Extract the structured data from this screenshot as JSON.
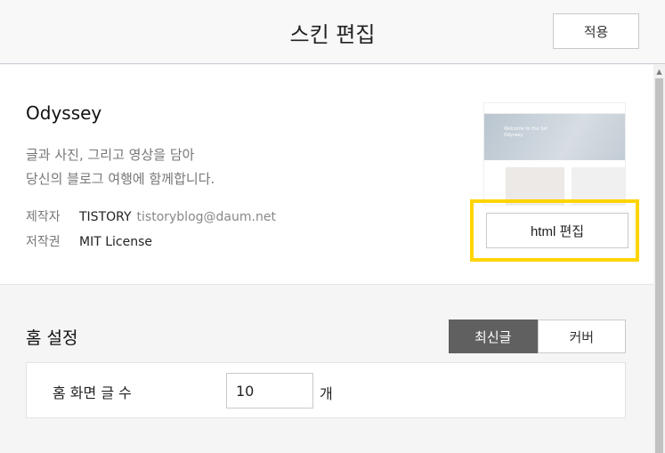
{
  "header": {
    "title": "스킨 편집",
    "apply_label": "적용"
  },
  "skin": {
    "name": "Odyssey",
    "description_line1": "글과 사진, 그리고 영상을 담아",
    "description_line2": "당신의 블로그 여행에 함께합니다.",
    "author_label": "제작자",
    "author_name": "TISTORY",
    "author_email": "tistoryblog@daum.net",
    "license_label": "저작권",
    "license_value": "MIT License",
    "html_edit_label": "html 편집",
    "preview": {
      "hero_text_line1": "Welcome to the 1st",
      "hero_text_line2": "Odyssey"
    }
  },
  "home_settings": {
    "title": "홈 설정",
    "toggle_options": [
      "최신글",
      "커버"
    ],
    "selected_option": "최신글",
    "post_count_label": "홈 화면 글 수",
    "post_count_value": "10",
    "post_count_unit": "개"
  },
  "colors": {
    "highlight": "#ffd400",
    "active_toggle": "#606060"
  }
}
